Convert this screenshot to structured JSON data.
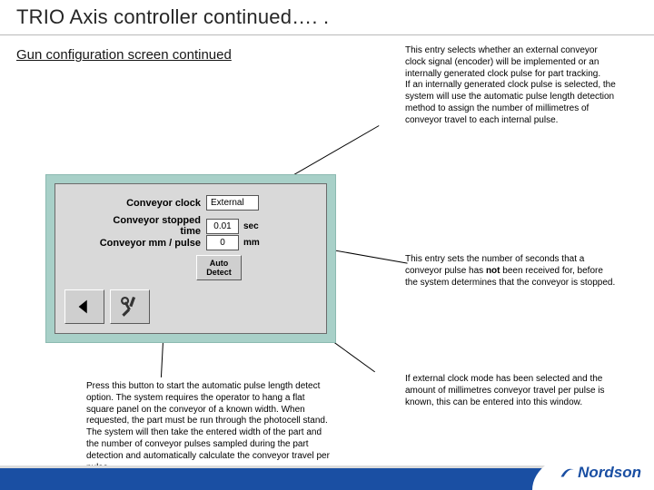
{
  "title": "TRIO Axis controller continued…. .",
  "subtitle": "Gun configuration screen continued",
  "panel": {
    "row1": {
      "label": "Conveyor clock",
      "value": "External"
    },
    "row2": {
      "label": "Conveyor stopped time",
      "value": "0.01",
      "unit": "sec"
    },
    "row3": {
      "label": "Conveyor mm / pulse",
      "value": "0",
      "unit": "mm"
    },
    "autoDetect": "Auto Detect"
  },
  "annotations": {
    "right1a": "This entry selects whether an external conveyor clock signal (encoder) will be implemented or an internally generated clock pulse for part tracking.",
    "right1b": "If an internally generated clock pulse is selected, the system will use the automatic pulse length detection method to assign the number of millimetres of conveyor travel to each internal pulse.",
    "right2a": "This entry sets the number of seconds that a conveyor pulse has ",
    "right2bold": "not",
    "right2b": " been received for, before the system determines that the conveyor is stopped.",
    "right3": "If external clock mode has been selected and the amount of millimetres conveyor travel per pulse is known, this can be entered into this window.",
    "bottom": "Press this button to start the automatic pulse length detect option. The system requires the operator to hang a flat square panel on the conveyor of a known width. When requested, the part must be run through the photocell stand. The system will then take the entered width of the part and the number of conveyor pulses sampled during the part detection and automatically calculate the conveyor travel per pulse."
  },
  "brand": "Nordson"
}
